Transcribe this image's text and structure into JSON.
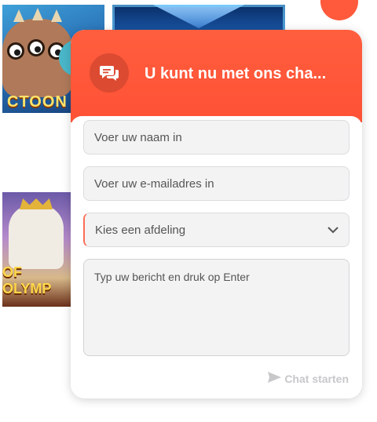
{
  "background": {
    "games": [
      {
        "name": "game-tile-1",
        "text": "CTOON"
      },
      {
        "name": "game-tile-2",
        "text": ""
      },
      {
        "name": "game-tile-3",
        "text": "OF OLYMP"
      }
    ]
  },
  "chat": {
    "header_title": "U kunt nu met ons cha...",
    "header_icon": "chat-bubbles-icon",
    "name_placeholder": "Voer uw naam in",
    "email_placeholder": "Voer uw e-mailadres in",
    "department_placeholder": "Kies een afdeling",
    "message_placeholder": "Typ uw bericht en druk op Enter",
    "start_button": "Chat starten",
    "start_icon": "send-icon",
    "accent_color": "#ff5a3c"
  }
}
